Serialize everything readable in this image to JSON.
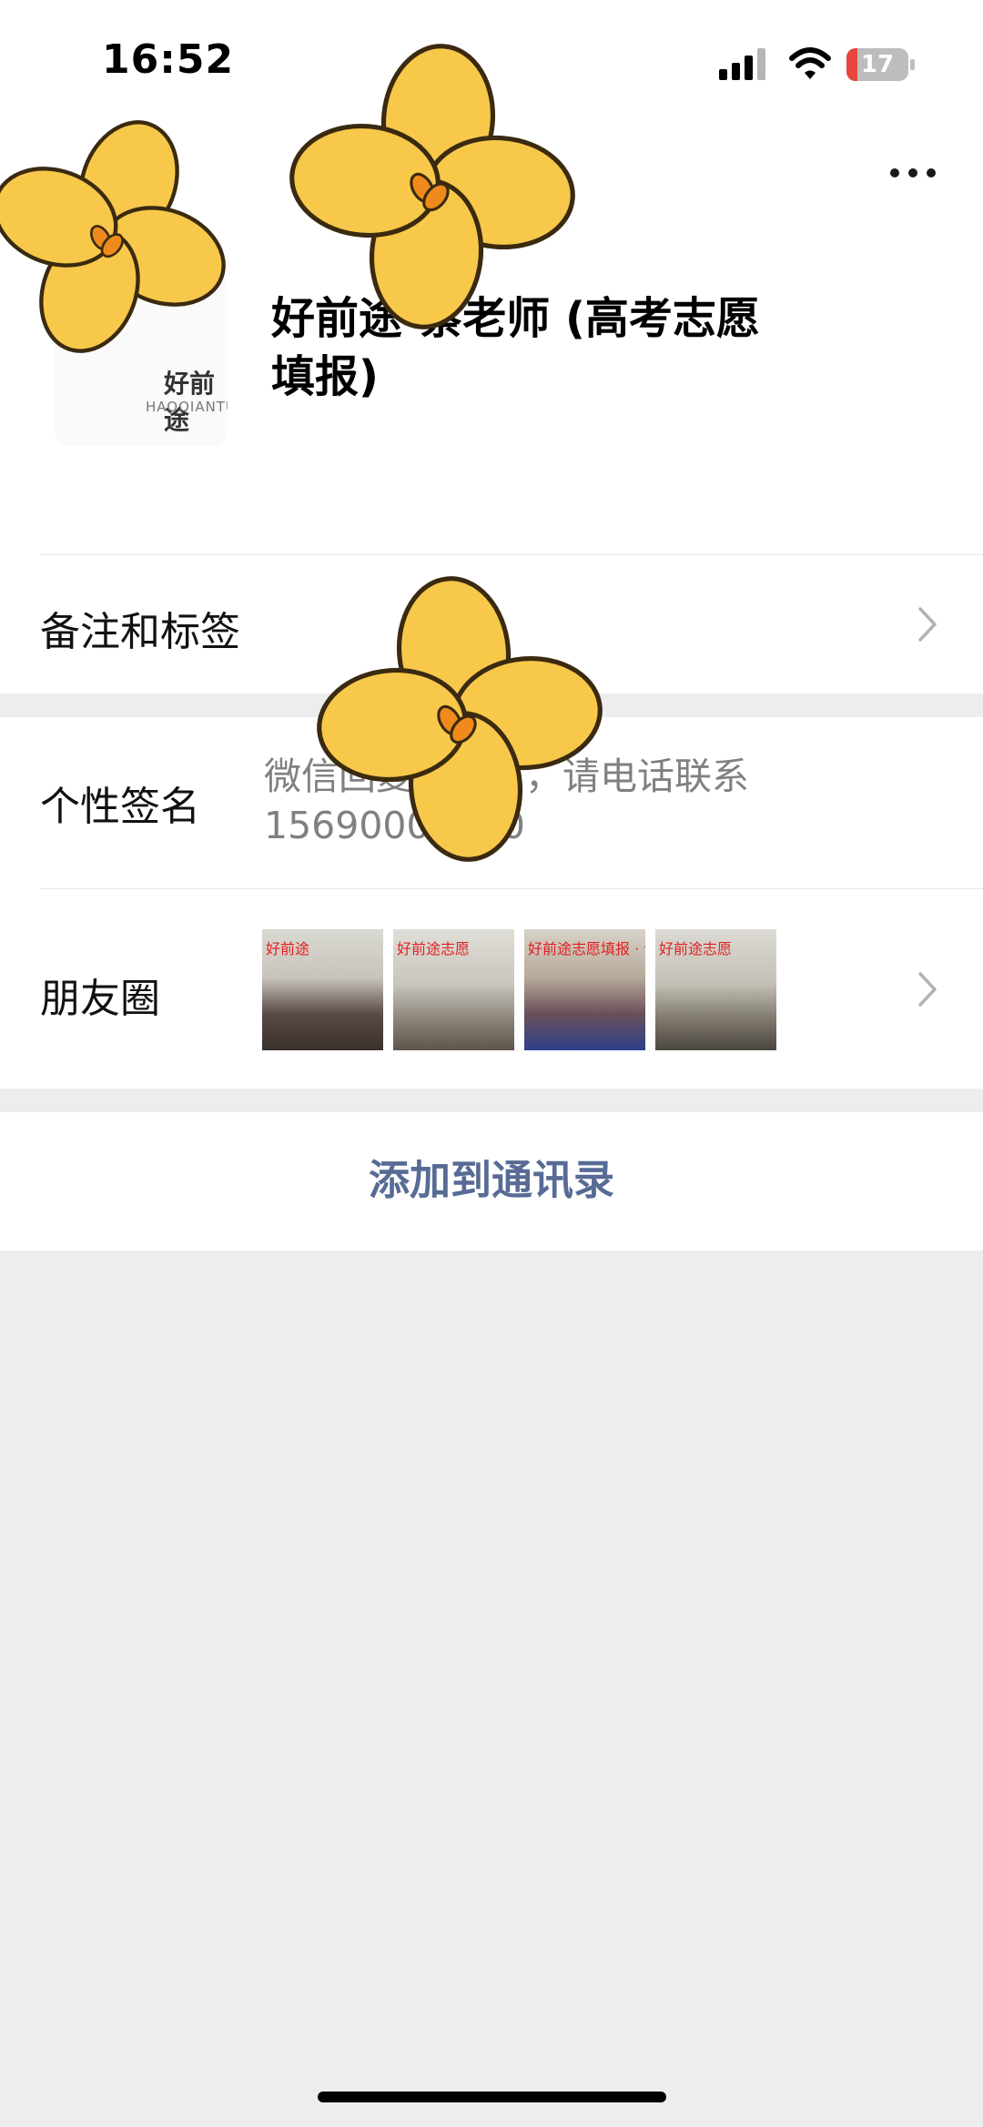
{
  "status_bar": {
    "time": "16:52",
    "battery": "17",
    "battery_level": 0.17
  },
  "profile": {
    "avatar_text": "好前途",
    "avatar_subtext": "HAOQIANTU",
    "name": "好前途·蔡老师 (高考志愿填报)"
  },
  "rows": {
    "remarks_label": "备注和标签",
    "signature_label": "个性签名",
    "signature_value": "微信回复不及时，请电话联系15690000000",
    "moments_label": "朋友圈",
    "moments_thumbs": [
      {
        "caption": "好前途"
      },
      {
        "caption": "好前途志愿"
      },
      {
        "caption": "好前途志愿填报 · 讲座"
      },
      {
        "caption": "好前途志愿"
      }
    ]
  },
  "actions": {
    "add_contact": "添加到通讯录"
  },
  "colors": {
    "link": "#576b95",
    "page_bg": "#ededed",
    "sticker_yellow": "#f7c84a",
    "sticker_orange": "#f08a1c"
  },
  "icons": [
    "signal-icon",
    "wifi-icon",
    "battery-icon",
    "more-icon",
    "chevron-right-icon",
    "flower-sticker-icon"
  ]
}
